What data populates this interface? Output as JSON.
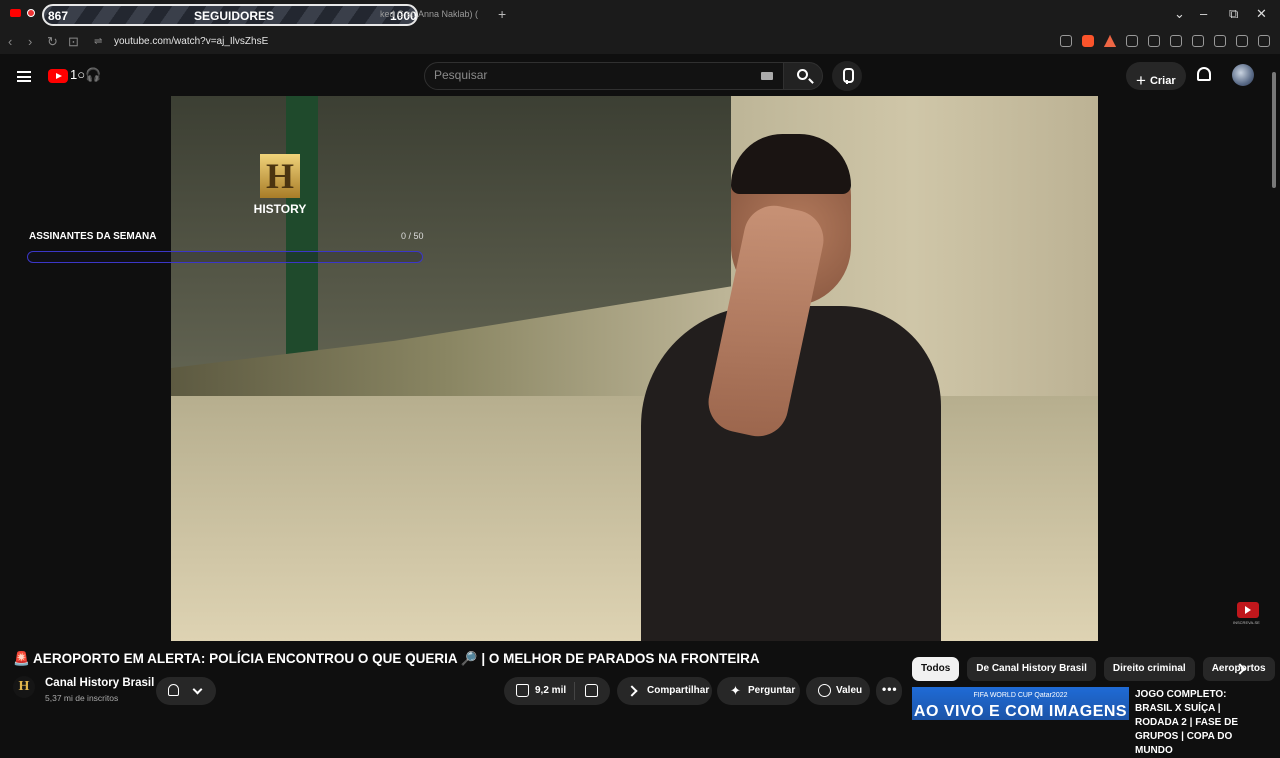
{
  "browser": {
    "tab_text": "ked G    st. Anna Naklab) (",
    "url": "youtube.com/watch?v=aj_IlvsZhsE"
  },
  "follower_goal": {
    "current": "867",
    "label": "SEGUIDORES",
    "target": "1000",
    "progress": 0.867
  },
  "header": {
    "search_placeholder": "Pesquisar",
    "create_label": "Criar",
    "doodle": "1○🎧"
  },
  "video": {
    "overlay_logo": "HISTORY",
    "watermark": "INSCREVA-SE"
  },
  "subs_overlay": {
    "label": "ASSINANTES DA SEMANA",
    "count": "0 / 50",
    "progress": 0
  },
  "video_info": {
    "title_emoji_left": "🚨",
    "title": " AEROPORTO EM ALERTA: POLÍCIA ENCONTROU O QUE QUERIA ",
    "title_emoji_right": "🔎",
    "title_tail": " | O MELHOR DE PARADOS NA FRONTEIRA",
    "channel_avatar": "H",
    "channel_name": "Canal History Brasil",
    "subscribers": "5,37 mi de inscritos",
    "likes": "9,2 mil",
    "share_label": "Compartilhar",
    "ask_label": "Perguntar",
    "thanks_label": "Valeu"
  },
  "chips": [
    "Todos",
    "De Canal History Brasil",
    "Direito criminal",
    "Aeroportos"
  ],
  "recommendation": {
    "thumb_small": "FIFA WORLD CUP Qatar2022",
    "thumb_big": "AO VIVO E COM IMAGENS",
    "title": "JOGO COMPLETO: BRASIL X SUÍÇA | RODADA 2 | FASE DE GRUPOS | COPA DO MUNDO"
  }
}
